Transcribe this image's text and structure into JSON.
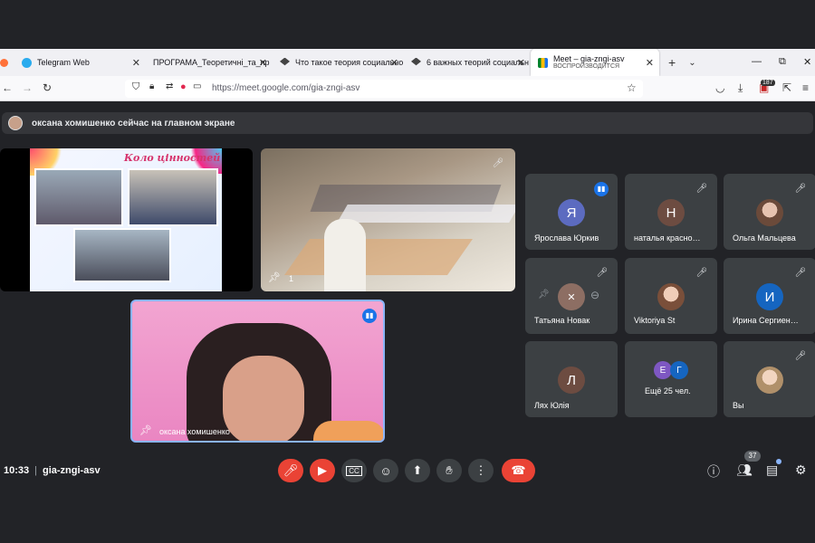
{
  "browser": {
    "tabs": [
      {
        "label": "Telegram Web"
      },
      {
        "label": "ПРОГРАМА_Теоретичні_та_пр"
      },
      {
        "label": "Что такое теория социально"
      },
      {
        "label": "6 важных теорий социальн"
      },
      {
        "label": "Meet – gia-zngi-asv",
        "sub": "ВОСПРОИЗВОДИТСЯ"
      }
    ],
    "url": "https://meet.google.com/gia-zngi-asv",
    "ext_badge": "187"
  },
  "banner": {
    "text": "оксана хомишенко сейчас на главном экране"
  },
  "presentation": {
    "slide_title": "Коло цінностей"
  },
  "class_tile": {
    "pin_count": "1"
  },
  "speaker": {
    "name": "оксана хомишенко"
  },
  "participants": [
    {
      "name": "Ярослава Юркив",
      "initial": "Я",
      "color": "#5c6bc0"
    },
    {
      "name": "наталья красно…",
      "initial": "Н",
      "color": "#6d4c41"
    },
    {
      "name": "Ольга Мальцева",
      "initial": "",
      "color": "#a08070"
    },
    {
      "name": "Татьяна Новак",
      "initial": "",
      "color": "#8d6e63"
    },
    {
      "name": "Viktoriya St",
      "initial": "",
      "color": "#b38b7a"
    },
    {
      "name": "Ирина Сергиен…",
      "initial": "И",
      "color": "#1565c0"
    },
    {
      "name": "Лях Юлія",
      "initial": "Л",
      "color": "#6d4c41"
    },
    {
      "name": "Ещё 25 чел.",
      "initial1": "Е",
      "initial2": "Г",
      "color": "#7e57c2"
    },
    {
      "name": "Вы",
      "initial": "",
      "color": "#c0a080"
    }
  ],
  "controls": {
    "time": "10:33",
    "separator": "|",
    "meeting_code": "gia-zngi-asv",
    "people_count": "37"
  }
}
